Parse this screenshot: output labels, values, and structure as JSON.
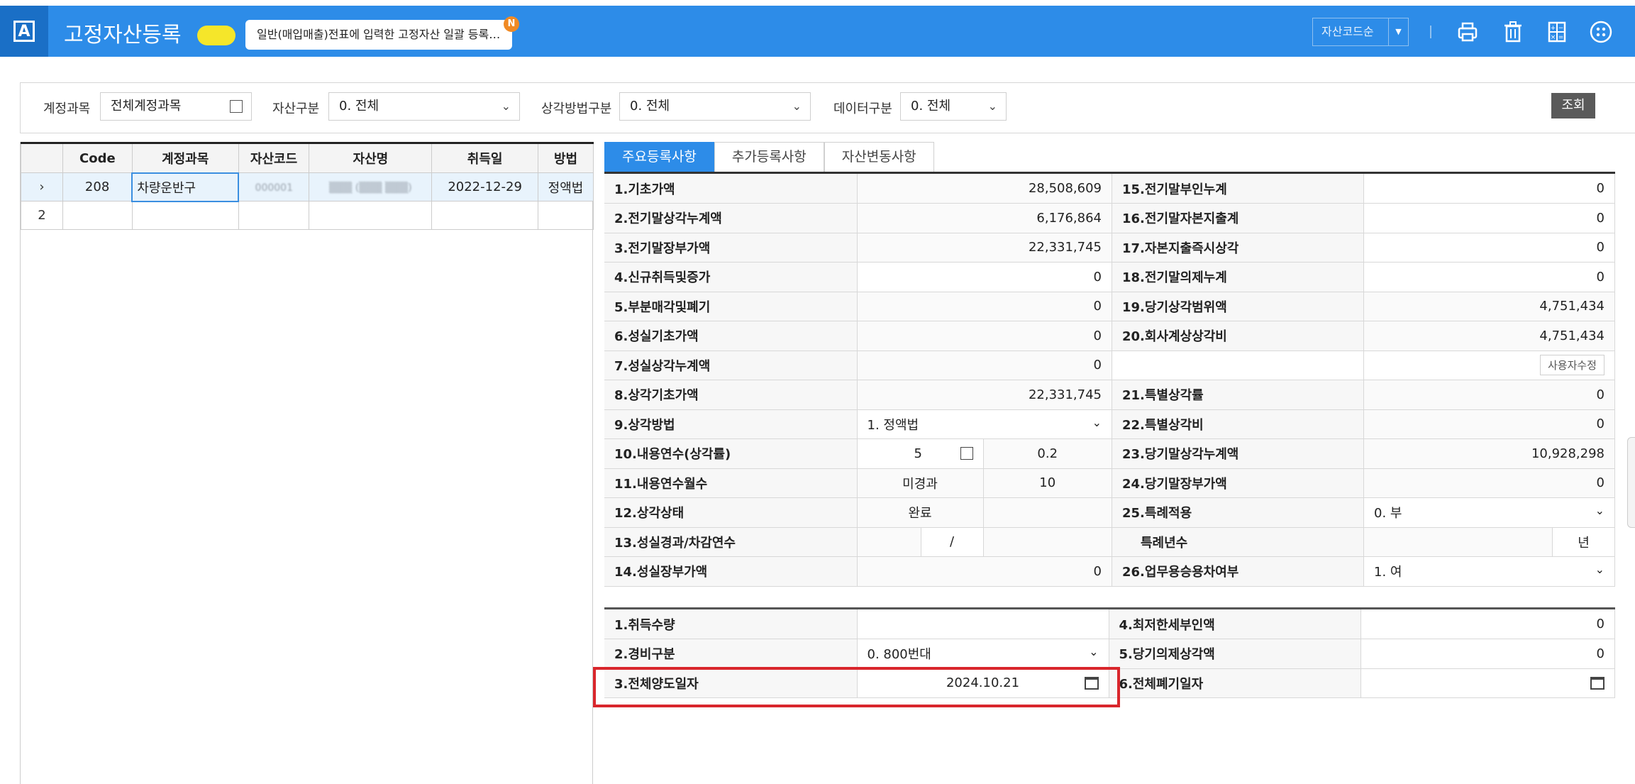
{
  "header": {
    "logo_letter": "A",
    "title": "고정자산등록",
    "notice_text": "일반(매입매출)전표에 입력한 고정자산 일괄 등록…",
    "notice_badge": "N",
    "sort_select": "자산코드순",
    "icons": [
      "print-icon",
      "trash-icon",
      "calculator-icon",
      "menu-dots-icon"
    ]
  },
  "filters": {
    "account_label": "계정과목",
    "account_value": "전체계정과목",
    "asset_type_label": "자산구분",
    "asset_type_value": "0. 전체",
    "dep_method_label": "상각방법구분",
    "dep_method_value": "0. 전체",
    "data_type_label": "데이터구분",
    "data_type_value": "0. 전체",
    "search_button": "조회"
  },
  "grid": {
    "columns": [
      "",
      "Code",
      "계정과목",
      "자산코드",
      "자산명",
      "취득일",
      "방법"
    ],
    "rows": [
      {
        "marker": "›",
        "code": "208",
        "account": "차량운반구",
        "asset_code": "000001",
        "asset_name": "(blurred)",
        "acquired": "2022-12-29",
        "method": "정액법"
      },
      {
        "marker": "2",
        "code": "",
        "account": "",
        "asset_code": "",
        "asset_name": "",
        "acquired": "",
        "method": ""
      }
    ]
  },
  "tabs": [
    "주요등록사항",
    "추가등록사항",
    "자산변동사항"
  ],
  "main_form": {
    "r1": {
      "l": "1.기초가액",
      "v": "28,508,609",
      "l2": "15.전기말부인누계",
      "v2": "0"
    },
    "r2": {
      "l": "2.전기말상각누계액",
      "v": "6,176,864",
      "l2": "16.전기말자본지출계",
      "v2": "0"
    },
    "r3": {
      "l": "3.전기말장부가액",
      "v": "22,331,745",
      "l2": "17.자본지출즉시상각",
      "v2": "0"
    },
    "r4": {
      "l": "4.신규취득및증가",
      "v": "0",
      "l2": "18.전기말의제누계",
      "v2": "0"
    },
    "r5": {
      "l": "5.부분매각및폐기",
      "v": "0",
      "l2": "19.당기상각범위액",
      "v2": "4,751,434"
    },
    "r6": {
      "l": "6.성실기초가액",
      "v": "0",
      "l2": "20.회사계상상각비",
      "v2": "4,751,434"
    },
    "r7": {
      "l": "7.성실상각누계액",
      "v": "0",
      "btn": "사용자수정"
    },
    "r8": {
      "l": "8.상각기초가액",
      "v": "22,331,745",
      "l2": "21.특별상각률",
      "v2": "0"
    },
    "r9": {
      "l": "9.상각방법",
      "v": "1. 정액법",
      "l2": "22.특별상각비",
      "v2": "0"
    },
    "r10": {
      "l": "10.내용연수(상각률)",
      "v": "5",
      "v_rate": "0.2",
      "l2": "23.당기말상각누계액",
      "v2": "10,928,298"
    },
    "r11": {
      "l": "11.내용연수월수",
      "v": "미경과",
      "v_b": "10",
      "l2": "24.당기말장부가액",
      "v2": "0"
    },
    "r12": {
      "l": "12.상각상태",
      "v": "완료",
      "l2": "25.특례적용",
      "v2": "0. 부"
    },
    "r13": {
      "l": "13.성실경과/차감연수",
      "v": "/",
      "l2": "특례년수",
      "v2": "년"
    },
    "r14": {
      "l": "14.성실장부가액",
      "v": "0",
      "l2": "26.업무용승용차여부",
      "v2": "1. 여"
    }
  },
  "sub_form": {
    "r1": {
      "l": "1.취득수량",
      "v": "",
      "l2": "4.최저한세부인액",
      "v2": "0"
    },
    "r2": {
      "l": "2.경비구분",
      "v": "0. 800번대",
      "l2": "5.당기의제상각액",
      "v2": "0"
    },
    "r3": {
      "l": "3.전체양도일자",
      "v": "2024.10.21",
      "l2": "6.전체폐기일자",
      "v2": ""
    }
  },
  "colors": {
    "header_blue": "#2d8ce8",
    "highlight_red": "#d9262c",
    "active_tab": "#2d8ce8"
  }
}
